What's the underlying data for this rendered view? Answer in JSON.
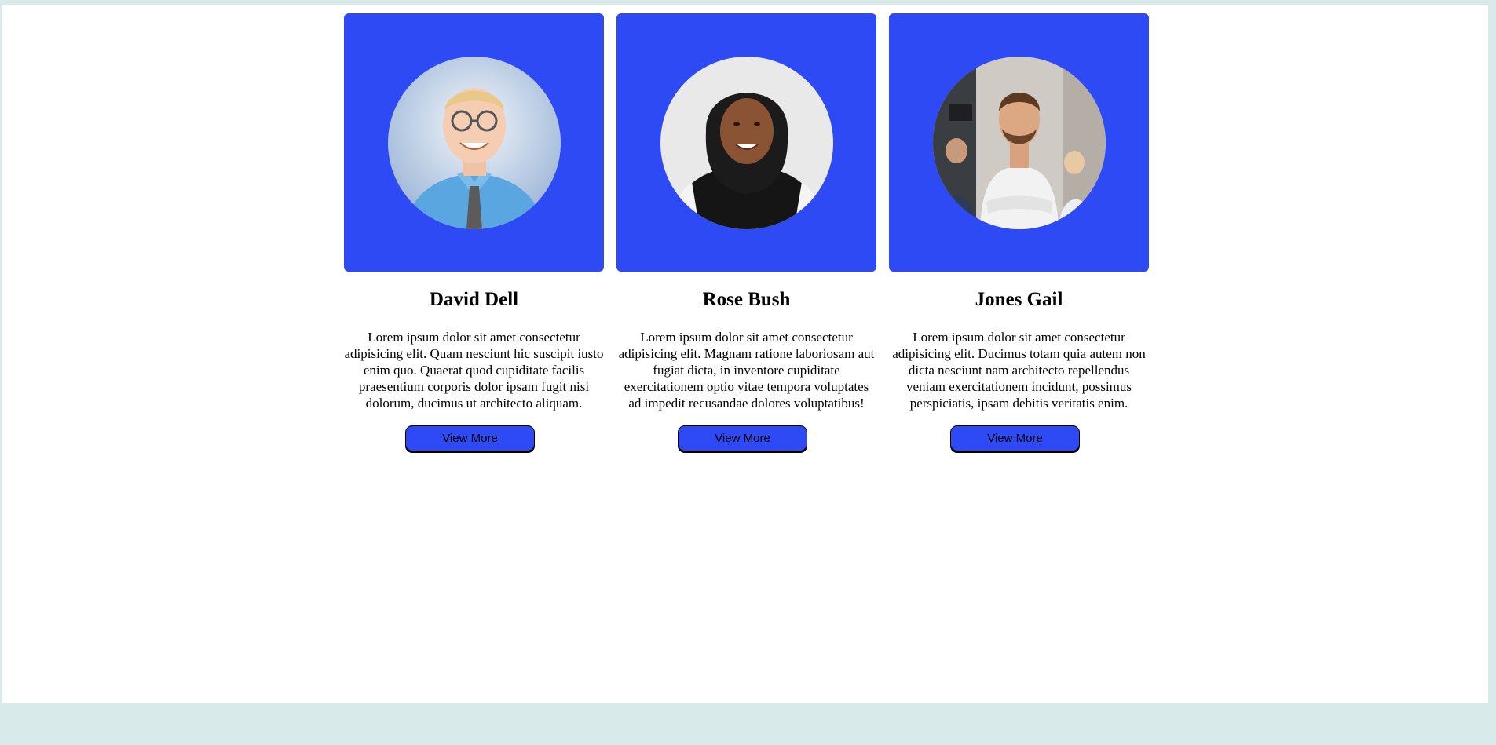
{
  "team": {
    "cards": [
      {
        "name": "David Dell",
        "photo_icon": "person-photo-icon",
        "description": "Lorem ipsum dolor sit amet consectetur adipisicing elit. Quam nesciunt hic suscipit iusto enim quo. Quaerat quod cupiditate facilis praesentium corporis dolor ipsam fugit nisi dolorum, ducimus ut architecto aliquam.",
        "button_label": "View More"
      },
      {
        "name": "Rose Bush",
        "photo_icon": "person-photo-icon",
        "description": "Lorem ipsum dolor sit amet consectetur adipisicing elit. Magnam ratione laboriosam aut fugiat dicta, in inventore cupiditate exercitationem optio vitae tempora voluptates ad impedit recusandae dolores voluptatibus!",
        "button_label": "View More"
      },
      {
        "name": "Jones Gail",
        "photo_icon": "person-photo-icon",
        "description": "Lorem ipsum dolor sit amet consectetur adipisicing elit. Ducimus totam quia autem non dicta nesciunt nam architecto repellendus veniam exercitationem incidunt, possimus perspiciatis, ipsam debitis veritatis enim.",
        "button_label": "View More"
      }
    ]
  },
  "colors": {
    "accent": "#2d4af5",
    "page_background": "#ffffff",
    "outer_background": "#d8eae9"
  }
}
